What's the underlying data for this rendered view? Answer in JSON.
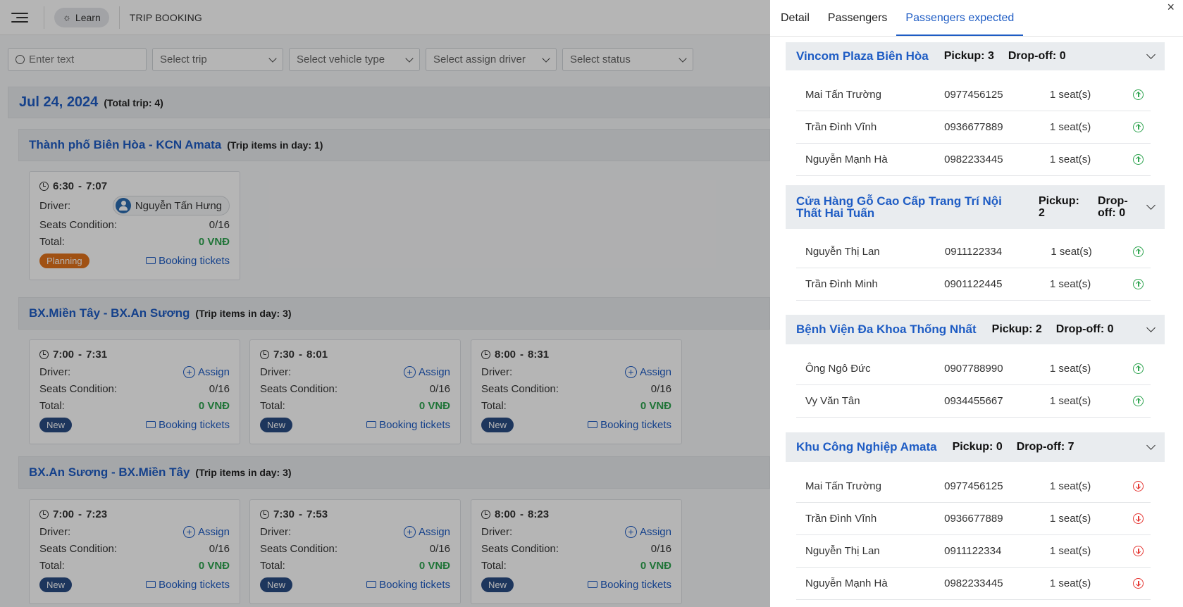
{
  "header": {
    "learn_label": "Learn",
    "title": "TRIP BOOKING"
  },
  "filters": {
    "search_placeholder": "Enter text",
    "trip": "Select trip",
    "vehicle": "Select vehicle type",
    "driver": "Select assign driver",
    "status": "Select status"
  },
  "day": {
    "date": "Jul 24, 2024",
    "total": "(Total trip: 4)"
  },
  "labels": {
    "driver": "Driver:",
    "seats": "Seats Condition:",
    "total": "Total:",
    "assign": "Assign",
    "booking": "Booking tickets",
    "status_new": "New",
    "status_planning": "Planning",
    "vnd": "0 VNĐ",
    "seats_val": "0/16",
    "sep": "-"
  },
  "routes": [
    {
      "name": "Thành phố Biên Hòa - KCN Amata",
      "count": "(Trip items in day: 1)",
      "trips": [
        {
          "start": "6:30",
          "end": "7:07",
          "driver": "Nguyễn Tấn Hưng"
        }
      ]
    },
    {
      "name": "BX.Miền Tây - BX.An Sương",
      "count": "(Trip items in day: 3)",
      "trips": [
        {
          "start": "7:00",
          "end": "7:31"
        },
        {
          "start": "7:30",
          "end": "8:01"
        },
        {
          "start": "8:00",
          "end": "8:31"
        }
      ]
    },
    {
      "name": "BX.An Sương - BX.Miền Tây",
      "count": "(Trip items in day: 3)",
      "trips": [
        {
          "start": "7:00",
          "end": "7:23"
        },
        {
          "start": "7:30",
          "end": "7:53"
        },
        {
          "start": "8:00",
          "end": "8:23"
        }
      ]
    }
  ],
  "panel": {
    "tabs": [
      "Detail",
      "Passengers",
      "Passengers expected"
    ],
    "close": "×",
    "groups": [
      {
        "name": "Vincom Plaza Biên Hòa",
        "pickup": "Pickup: 3",
        "dropoff": "Drop-off: 0",
        "passengers": [
          {
            "name": "Mai Tấn Trường",
            "phone": "0977456125",
            "seats": "1 seat(s)"
          },
          {
            "name": "Trần Đình Vĩnh",
            "phone": "0936677889",
            "seats": "1 seat(s)"
          },
          {
            "name": "Nguyễn Mạnh Hà",
            "phone": "0982233445",
            "seats": "1 seat(s)"
          }
        ]
      },
      {
        "name": "Cửa Hàng Gỗ Cao Cấp Trang Trí Nội Thất Hai Tuấn",
        "pickup": "Pickup: 2",
        "dropoff": "Drop-off: 0",
        "passengers": [
          {
            "name": "Nguyễn Thị Lan",
            "phone": "0911122334",
            "seats": "1 seat(s)"
          },
          {
            "name": "Trần Đình Minh",
            "phone": "0901122445",
            "seats": "1 seat(s)"
          }
        ]
      },
      {
        "name": "Bệnh Viện Đa Khoa Thống Nhất",
        "pickup": "Pickup: 2",
        "dropoff": "Drop-off: 0",
        "passengers": [
          {
            "name": "Ông Ngô Đức",
            "phone": "0907788990",
            "seats": "1 seat(s)"
          },
          {
            "name": "Vy Văn Tân",
            "phone": "0934455667",
            "seats": "1 seat(s)"
          }
        ]
      },
      {
        "name": "Khu Công Nghiệp Amata",
        "pickup": "Pickup: 0",
        "dropoff": "Drop-off: 7",
        "passengers": [
          {
            "name": "Mai Tấn Trường",
            "phone": "0977456125",
            "seats": "1 seat(s)"
          },
          {
            "name": "Trần Đình Vĩnh",
            "phone": "0936677889",
            "seats": "1 seat(s)"
          },
          {
            "name": "Nguyễn Thị Lan",
            "phone": "0911122334",
            "seats": "1 seat(s)"
          },
          {
            "name": "Nguyễn Mạnh Hà",
            "phone": "0982233445",
            "seats": "1 seat(s)"
          }
        ]
      }
    ]
  }
}
